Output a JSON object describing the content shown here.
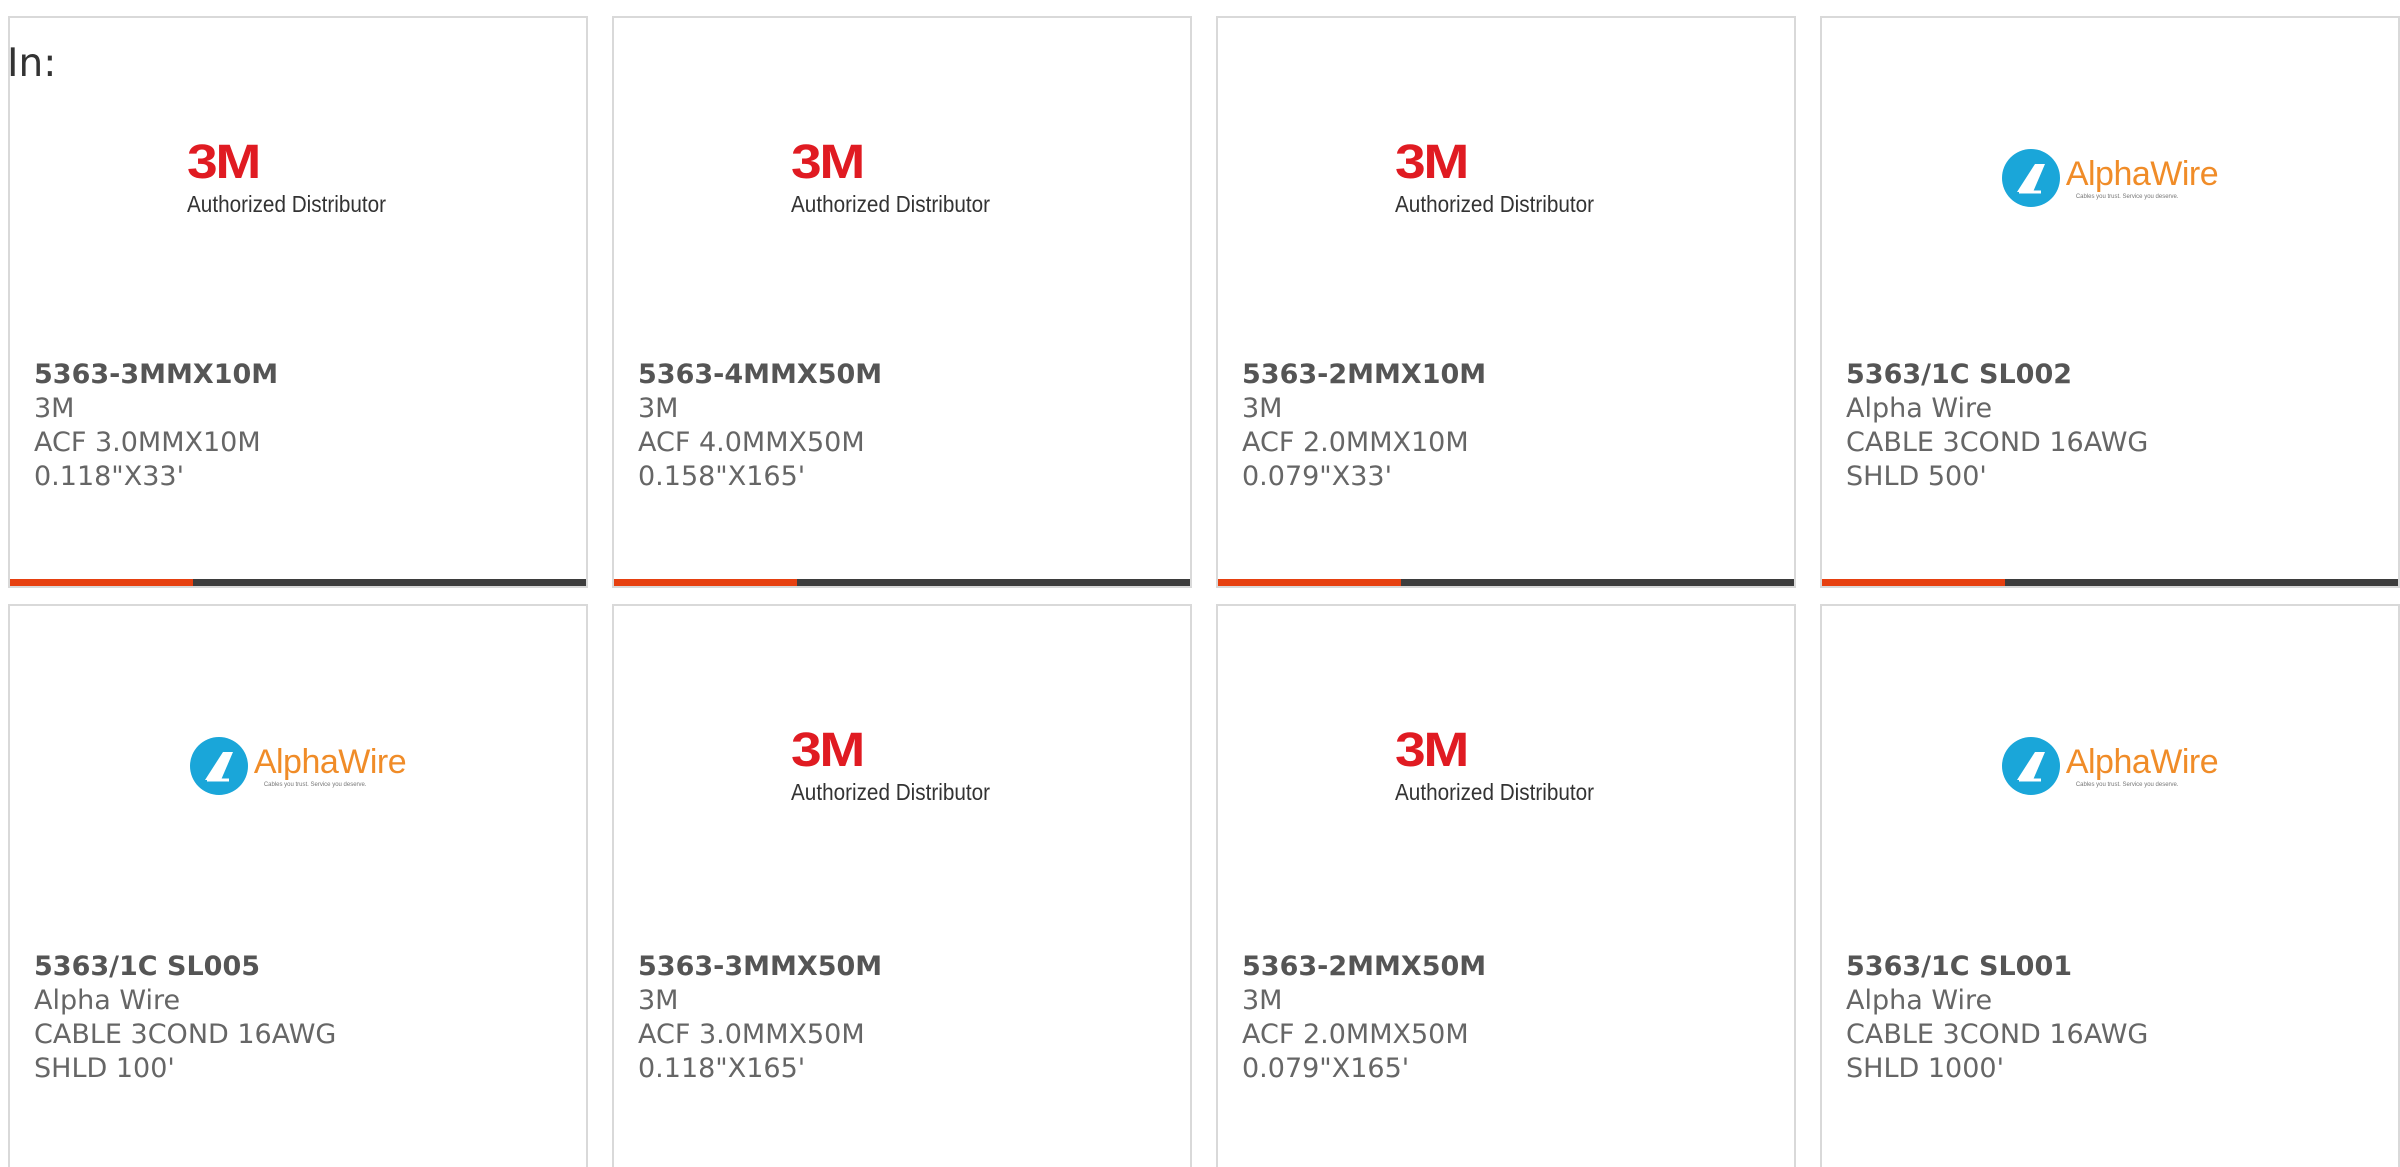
{
  "header": {
    "in_label": "In:"
  },
  "colors": {
    "accent_bar": "#e64010",
    "brand_3m": "#e01b22",
    "alphawire_blue": "#1aa6d9",
    "alphawire_orange": "#f08c28"
  },
  "cards": [
    {
      "part_number": "5363-3MMX10M",
      "manufacturer": "3M",
      "description": "ACF 3.0MMX10M 0.118\"X33'",
      "logo": {
        "type": "3m",
        "mark": "3M",
        "subtitle": "Authorized Distributor"
      }
    },
    {
      "part_number": "5363-4MMX50M",
      "manufacturer": "3M",
      "description": "ACF 4.0MMX50M 0.158\"X165'",
      "logo": {
        "type": "3m",
        "mark": "3M",
        "subtitle": "Authorized Distributor"
      }
    },
    {
      "part_number": "5363-2MMX10M",
      "manufacturer": "3M",
      "description": "ACF 2.0MMX10M 0.079\"X33'",
      "logo": {
        "type": "3m",
        "mark": "3M",
        "subtitle": "Authorized Distributor"
      }
    },
    {
      "part_number": "5363/1C SL002",
      "manufacturer": "Alpha Wire",
      "description": "CABLE 3COND 16AWG SHLD 500'",
      "logo": {
        "type": "alphawire",
        "wordmark": "AlphaWire",
        "tagline": "Cables you trust. Service you deserve."
      }
    },
    {
      "part_number": "5363/1C SL005",
      "manufacturer": "Alpha Wire",
      "description": "CABLE 3COND 16AWG SHLD 100'",
      "logo": {
        "type": "alphawire",
        "wordmark": "AlphaWire",
        "tagline": "Cables you trust. Service you deserve."
      }
    },
    {
      "part_number": "5363-3MMX50M",
      "manufacturer": "3M",
      "description": "ACF 3.0MMX50M 0.118\"X165'",
      "logo": {
        "type": "3m",
        "mark": "3M",
        "subtitle": "Authorized Distributor"
      }
    },
    {
      "part_number": "5363-2MMX50M",
      "manufacturer": "3M",
      "description": "ACF 2.0MMX50M 0.079\"X165'",
      "logo": {
        "type": "3m",
        "mark": "3M",
        "subtitle": "Authorized Distributor"
      }
    },
    {
      "part_number": "5363/1C SL001",
      "manufacturer": "Alpha Wire",
      "description": "CABLE 3COND 16AWG SHLD 1000'",
      "logo": {
        "type": "alphawire",
        "wordmark": "AlphaWire",
        "tagline": "Cables you trust. Service you deserve."
      }
    }
  ]
}
